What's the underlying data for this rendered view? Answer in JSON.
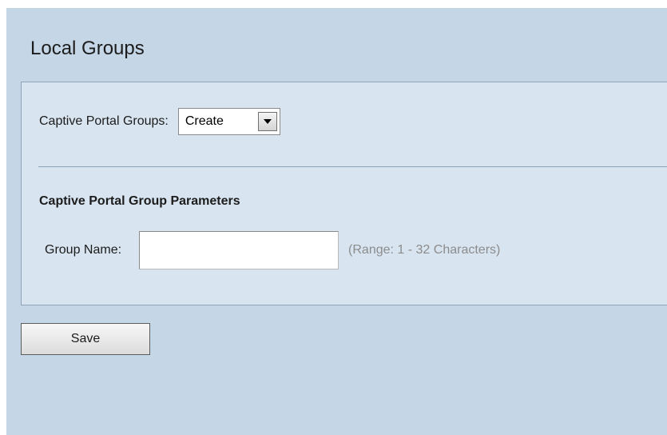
{
  "page": {
    "title": "Local Groups"
  },
  "groups_row": {
    "label": "Captive Portal Groups:",
    "select_value": "Create",
    "arrow_icon": "chevron-down-icon"
  },
  "parameters": {
    "heading": "Captive Portal Group Parameters",
    "group_name_label": "Group Name:",
    "group_name_value": "",
    "group_name_hint": "(Range: 1 - 32 Characters)"
  },
  "actions": {
    "save_label": "Save"
  },
  "colors": {
    "background": "#c5d6e6",
    "panel": "#d8e4ef",
    "border": "#8fa3b8",
    "hint_text": "#8c8c8c"
  }
}
